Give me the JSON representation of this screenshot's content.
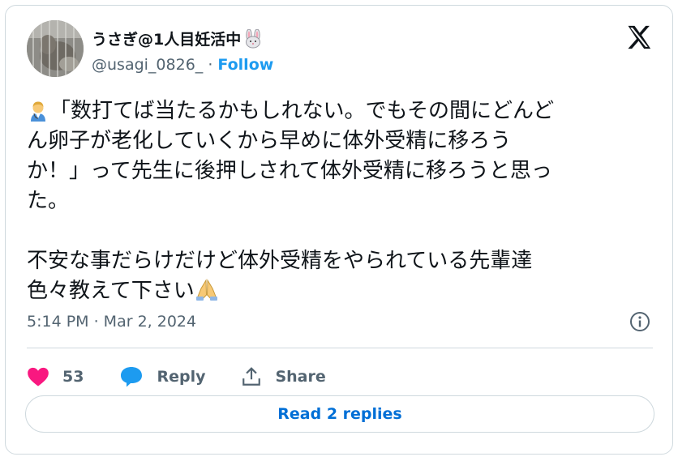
{
  "tweet": {
    "display_name": "うさぎ@1人目妊活中",
    "handle": "@usagi_0826_",
    "separator": " · ",
    "follow_label": "Follow",
    "lines": [
      "「数打てば当たるかもしれない。でもその間にどんど",
      "ん卵子が老化していくから早めに体外受精に移ろう",
      "か！」って先生に後押しされて体外受精に移ろうと思っ",
      "た。"
    ],
    "lines2": [
      "不安な事だらけだけど体外受精をやられている先輩達",
      "色々教えて下さい"
    ],
    "timestamp": "5:14 PM · Mar 2, 2024"
  },
  "actions": {
    "like_count": "53",
    "reply_label": "Reply",
    "share_label": "Share"
  },
  "read_replies_label": "Read 2 replies",
  "icons": {
    "avatar": "avatar-photo",
    "name_emoji": "rabbit-face-icon",
    "brand": "x-logo-icon",
    "first_emoji": "health-worker-icon",
    "last_emoji": "folded-hands-icon",
    "info": "info-icon",
    "like": "heart-icon",
    "reply": "speech-bubble-icon",
    "share": "share-icon"
  },
  "colors": {
    "like": "#f91880",
    "reply": "#1d9bf0",
    "link": "#1d9bf0",
    "read_button_text": "#006fd6",
    "secondary_text": "#536471",
    "border": "#cfd9de"
  }
}
